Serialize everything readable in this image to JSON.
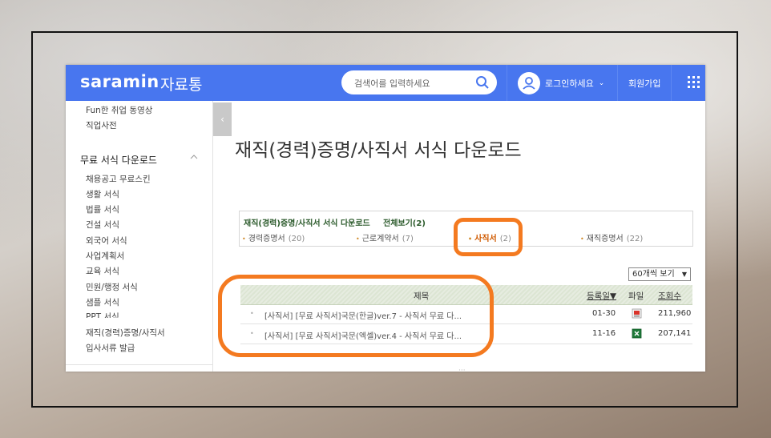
{
  "header": {
    "logo": "saramin",
    "logo_sub": "자료통",
    "search_placeholder": "검색어를 입력하세요",
    "login_label": "로그인하세요",
    "join_label": "회원가입"
  },
  "sidebar": {
    "top_items": [
      "Fun한 취업 동영상",
      "직업사전"
    ],
    "section_title": "무료 서식 다운로드",
    "items": [
      "채용공고 무료스킨",
      "생활 서식",
      "법률 서식",
      "건설 서식",
      "외국어 서식",
      "사업계획서",
      "교육 서식",
      "민원/행정 서식",
      "샘플 서식",
      "PPT 서식",
      "재직(경력)증명/사직서",
      "입사서류 발급"
    ]
  },
  "main": {
    "title": "재직(경력)증명/사직서 서식 다운로드",
    "categories": {
      "title": "재직(경력)증명/사직서 서식 다운로드",
      "all_label": "전체보기(2)",
      "items": [
        {
          "label": "경력증명서",
          "count": "(20)"
        },
        {
          "label": "근로계약서",
          "count": "(7)"
        },
        {
          "label": "사직서",
          "count": "(2)"
        },
        {
          "label": "재직증명서",
          "count": "(22)"
        }
      ]
    },
    "per_page": "60개씩 보기",
    "table": {
      "headers": {
        "title": "제목",
        "date": "등록일▼",
        "file": "파일",
        "views": "조회수"
      },
      "rows": [
        {
          "title": "[사직서] [무료 사직서]국문(한글)ver.7 - 사직서 무료 다...",
          "date": "01-30",
          "file_icon": "hwp-file-icon",
          "views": "211,960"
        },
        {
          "title": "[사직서] [무료 사직서]국문(엑셀)ver.4 - 사직서 무료 다...",
          "date": "11-16",
          "file_icon": "excel-file-icon",
          "views": "207,141"
        }
      ]
    }
  },
  "colors": {
    "header_bg": "#4876ef",
    "highlight": "#f47a20"
  }
}
